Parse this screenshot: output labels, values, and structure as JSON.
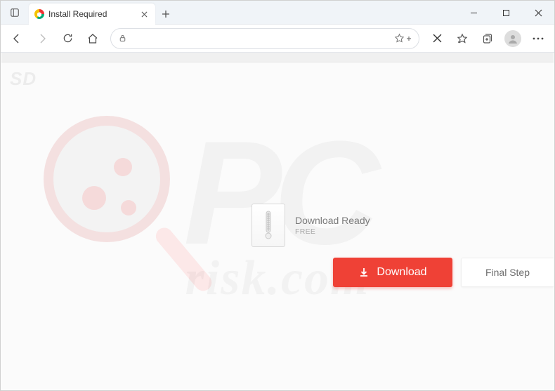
{
  "window": {
    "tab_title": "Install Required"
  },
  "toolbar": {
    "address_value": "",
    "address_placeholder": ""
  },
  "page": {
    "watermark_sd": "SD",
    "watermark_pc": "PC",
    "watermark_sub": "risk.com",
    "card": {
      "title": "Download Ready",
      "subtitle": "FREE"
    },
    "download_label": "Download",
    "final_label": "Final Step"
  }
}
